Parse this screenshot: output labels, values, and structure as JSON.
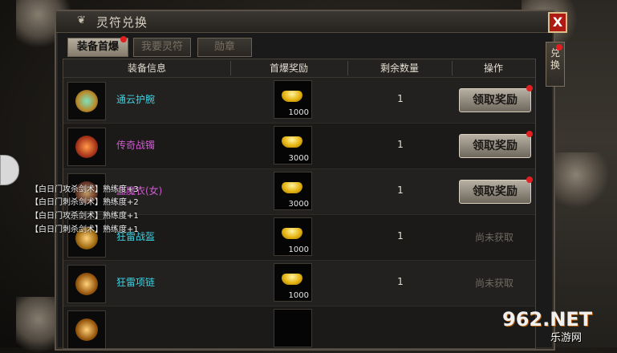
{
  "window": {
    "title": "灵符兑换",
    "close_label": "X"
  },
  "side_tab": {
    "label": "兑换"
  },
  "tabs": [
    {
      "label": "装备首爆",
      "active": true
    },
    {
      "label": "我要灵符",
      "active": false
    },
    {
      "label": "勋章",
      "active": false
    }
  ],
  "table": {
    "headers": [
      "装备信息",
      "首爆奖励",
      "剩余数量",
      "操作"
    ],
    "rows": [
      {
        "name": "通云护腕",
        "name_color": "#3fd1e0",
        "reward": "1000",
        "remain": "1",
        "action": "领取奖励",
        "claimable": true
      },
      {
        "name": "传奇战镯",
        "name_color": "#d05ad0",
        "reward": "3000",
        "remain": "1",
        "action": "领取奖励",
        "claimable": true
      },
      {
        "name": "血魔衣(女)",
        "name_color": "#d05ad0",
        "reward": "3000",
        "remain": "1",
        "action": "领取奖励",
        "claimable": true
      },
      {
        "name": "狂雷战盔",
        "name_color": "#3fd1e0",
        "reward": "1000",
        "remain": "1",
        "action": "尚未获取",
        "claimable": false
      },
      {
        "name": "狂雷项链",
        "name_color": "#3fd1e0",
        "reward": "1000",
        "remain": "1",
        "action": "尚未获取",
        "claimable": false
      }
    ]
  },
  "log_lines": [
    "【白日门攻杀剑术】熟练度+3",
    "【白日门刺杀剑术】熟练度+2",
    "【白日门攻杀剑术】熟练度+1",
    "【白日门刺杀剑术】熟练度+1"
  ],
  "watermark": {
    "logo": "962.NET",
    "sub": "乐游网"
  },
  "colors": {
    "accent_red": "#e02020",
    "gold": "#e5b410",
    "panel_bg": "#1a1a1a"
  }
}
